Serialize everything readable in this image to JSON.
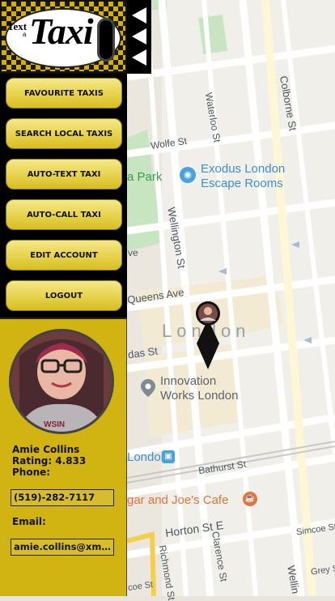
{
  "logo": {
    "text_small": "Text",
    "text_a": "a",
    "text_big": "Taxi"
  },
  "menu": {
    "favourite": "FAVOURITE TAXIS",
    "search": "SEARCH LOCAL TAXIS",
    "auto_text": "AUTO-TEXT TAXI",
    "auto_call": "AUTO-CALL TAXI",
    "edit": "EDIT ACCOUNT",
    "logout": "LOGOUT"
  },
  "profile": {
    "name": "Amie Collins",
    "rating": "Rating: 4.833",
    "phone_label": "Phone:",
    "phone": "(519)-282-7117",
    "email_label": "Email:",
    "email": "amie.collins@xmail.com"
  },
  "map": {
    "area": "London",
    "poi_exodus": "Exodus London\nEscape Rooms",
    "poi_innovation": "Innovation\nWorks London",
    "poi_cafe": "gar and Joe's Cafe",
    "poi_station": "London",
    "park": "a Park",
    "streets": {
      "colborne": "Colborne St",
      "waterloo": "Waterloo St",
      "wolfe": "Wolfe St",
      "wellington": "Wellington St",
      "queens": "Queens Ave",
      "das": "das St",
      "bathurst": "Bathurst St",
      "horton": "Horton St E",
      "simcoe": "Simcoe St",
      "clarence": "Clarence St",
      "richmond": "Richmond St",
      "coe": "coe St",
      "grey": "Grey St",
      "welling2": "Wellin",
      "ve": "ve"
    }
  },
  "colors": {
    "sidebar_bg": "#000000",
    "profile_bg": "#d1b312",
    "button_yellow": "#e8d44f"
  }
}
